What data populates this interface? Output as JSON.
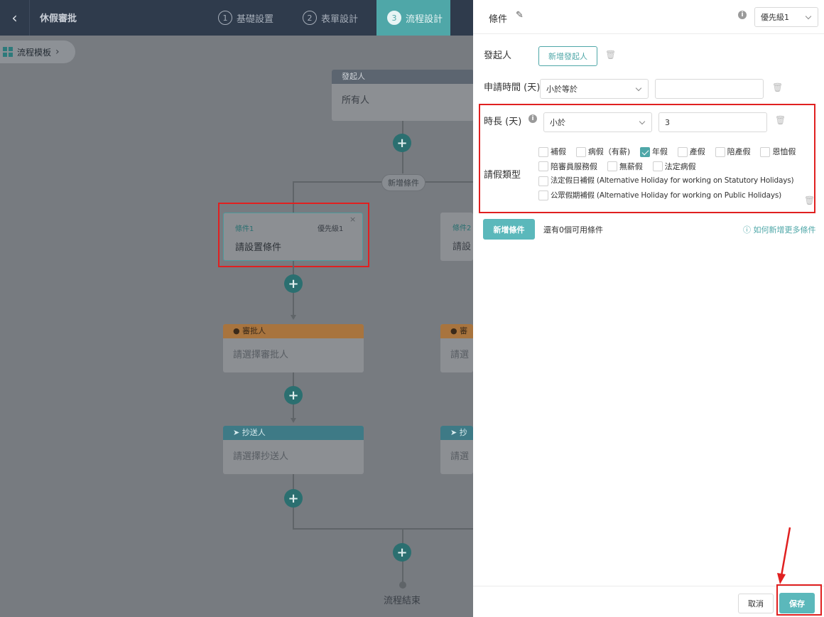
{
  "topbar": {
    "title": "休假審批",
    "steps": [
      {
        "num": "1",
        "label": "基礎設置"
      },
      {
        "num": "2",
        "label": "表單設計"
      },
      {
        "num": "3",
        "label": "流程設計"
      }
    ]
  },
  "canvas": {
    "template_label": "流程模板",
    "initiator": {
      "head": "發起人",
      "body": "所有人"
    },
    "add_condition_label": "新增條件",
    "condition1": {
      "name": "條件1",
      "priority": "優先級1",
      "body": "請設置條件"
    },
    "condition2": {
      "name": "條件2",
      "body": "請設"
    },
    "approver": {
      "head": "審批人",
      "body": "請選擇審批人"
    },
    "approver2": {
      "head": "審",
      "body": "請選"
    },
    "cc": {
      "head": "抄送人",
      "body": "請選擇抄送人"
    },
    "cc2": {
      "head": "抄",
      "body": "請選"
    },
    "end_label": "流程結束"
  },
  "panel": {
    "title": "條件",
    "priority_value": "優先級1",
    "initiator_label": "發起人",
    "add_initiator_button": "新增發起人",
    "apply_time": {
      "label": "申請時間 (天)",
      "operator": "小於等於",
      "value": ""
    },
    "duration": {
      "label": "時長 (天)",
      "operator": "小於",
      "value": "3"
    },
    "leave_type": {
      "label": "請假類型",
      "options": [
        {
          "label": "補假",
          "checked": false
        },
        {
          "label": "病假（有薪)",
          "checked": false
        },
        {
          "label": "年假",
          "checked": true
        },
        {
          "label": "產假",
          "checked": false
        },
        {
          "label": "陪產假",
          "checked": false
        },
        {
          "label": "恩恤假",
          "checked": false
        },
        {
          "label": "陪審員服務假",
          "checked": false
        },
        {
          "label": "無薪假",
          "checked": false
        },
        {
          "label": "法定病假",
          "checked": false
        },
        {
          "label": "法定假日補假 (Alternative Holiday for working on Statutory Holidays)",
          "checked": false
        },
        {
          "label": "公眾假期補假 (Alternative Holiday for working on Public Holidays)",
          "checked": false
        }
      ]
    },
    "add_condition_button": "新增條件",
    "remaining_text": "還有0個可用條件",
    "help_link": "如何新增更多條件",
    "cancel_button": "取消",
    "save_button": "保存"
  },
  "colors": {
    "accent": "#4fa7a8",
    "topbar": "#2f3b4c",
    "highlight": "#e02020"
  }
}
